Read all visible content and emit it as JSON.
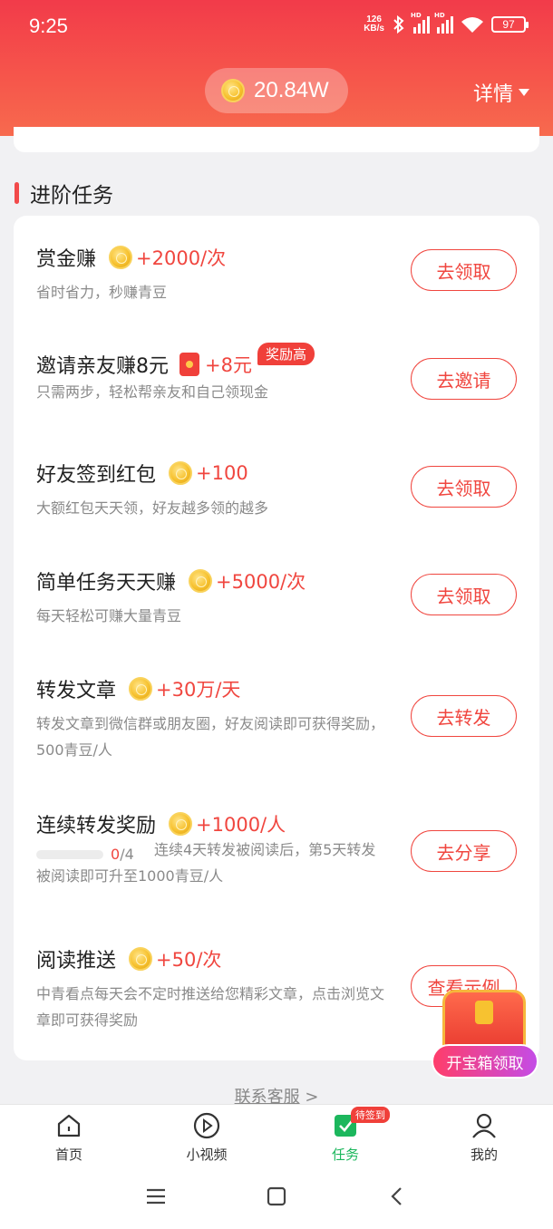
{
  "status_bar": {
    "time": "9:25",
    "net_speed_value": "126",
    "net_speed_unit": "KB/s",
    "signal_label": "HD",
    "battery": "97"
  },
  "header": {
    "coin_value": "20.84W",
    "details_label": "详情"
  },
  "section": {
    "title": "进阶任务"
  },
  "tasks": [
    {
      "title": "赏金赚",
      "reward": "+2000/次",
      "reward_icon": "coin-icon",
      "desc": "省时省力，秒赚青豆",
      "button": "去领取"
    },
    {
      "title": "邀请亲友赚8元",
      "reward": "+8元",
      "reward_icon": "red-packet-icon",
      "badge": "奖励高",
      "desc": "只需两步，轻松帮亲友和自己领现金",
      "button": "去邀请"
    },
    {
      "title": "好友签到红包",
      "reward": "+100",
      "reward_icon": "coin-icon",
      "desc": "大额红包天天领，好友越多领的越多",
      "button": "去领取"
    },
    {
      "title": "简单任务天天赚",
      "reward": "+5000/次",
      "reward_icon": "coin-icon",
      "desc": "每天轻松可赚大量青豆",
      "button": "去领取"
    },
    {
      "title": "转发文章",
      "reward": "+30万/天",
      "reward_icon": "coin-icon",
      "desc": "转发文章到微信群或朋友圈，好友阅读即可获得奖励，500青豆/人",
      "button": "去转发"
    },
    {
      "title": "连续转发奖励",
      "reward": "+1000/人",
      "reward_icon": "coin-icon",
      "progress_current": "0",
      "progress_total": "/4",
      "progress_fraction": 0,
      "desc": "连续4天转发被阅读后，第5天转发被阅读即可升至1000青豆/人",
      "button": "去分享"
    },
    {
      "title": "阅读推送",
      "reward": "+50/次",
      "reward_icon": "coin-icon",
      "desc": "中青看点每天会不定时推送给您精彩文章，点击浏览文章即可获得奖励",
      "button": "查看示例"
    }
  ],
  "floating": {
    "treasure_label": "开宝箱领取"
  },
  "footer": {
    "contact_label": "联系客服",
    "contact_arrow": ">"
  },
  "tabbar": [
    {
      "label": "首页",
      "icon": "home-icon"
    },
    {
      "label": "小视频",
      "icon": "play-icon"
    },
    {
      "label": "任务",
      "icon": "task-icon",
      "badge": "待签到",
      "active": true
    },
    {
      "label": "我的",
      "icon": "user-icon"
    }
  ],
  "colors": {
    "accent": "#f0463f",
    "header": "#f23b4a",
    "active_tab": "#1cb75d"
  }
}
